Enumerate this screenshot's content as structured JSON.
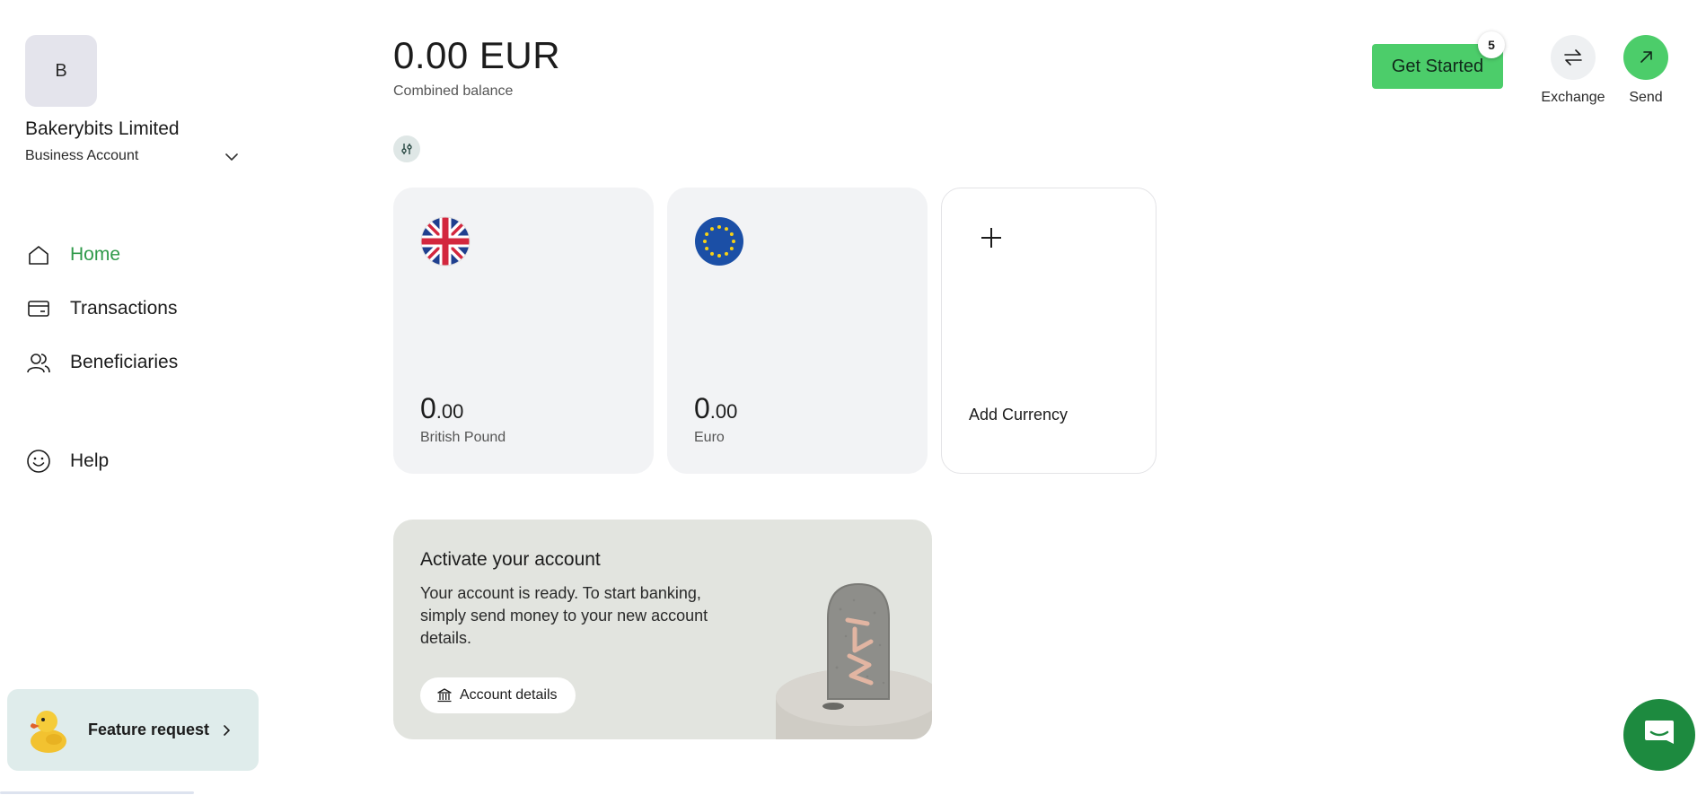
{
  "sidebar": {
    "avatar_initial": "B",
    "company_name": "Bakerybits Limited",
    "account_type": "Business Account",
    "nav": [
      {
        "label": "Home",
        "icon": "home-icon",
        "active": true
      },
      {
        "label": "Transactions",
        "icon": "card-icon",
        "active": false
      },
      {
        "label": "Beneficiaries",
        "icon": "people-icon",
        "active": false
      },
      {
        "label": "Help",
        "icon": "smiley-icon",
        "active": false
      }
    ],
    "feature_request_label": "Feature request"
  },
  "balance": {
    "amount": "0.00 EUR",
    "label": "Combined balance"
  },
  "currencies": [
    {
      "amount_int": "0",
      "amount_dec": ".00",
      "name": "British Pound",
      "flag": "uk-flag-icon"
    },
    {
      "amount_int": "0",
      "amount_dec": ".00",
      "name": "Euro",
      "flag": "eu-flag-icon"
    }
  ],
  "add_currency_label": "Add Currency",
  "activate": {
    "title": "Activate your account",
    "body": "Your account is ready. To start banking, simply send money to your new account details.",
    "button_label": "Account details"
  },
  "header": {
    "get_started_label": "Get Started",
    "get_started_badge": "5",
    "exchange_label": "Exchange",
    "send_label": "Send"
  },
  "colors": {
    "accent_green": "#4ccd6a",
    "active_nav": "#2f9a4a",
    "chat_button": "#1d8a3f"
  }
}
